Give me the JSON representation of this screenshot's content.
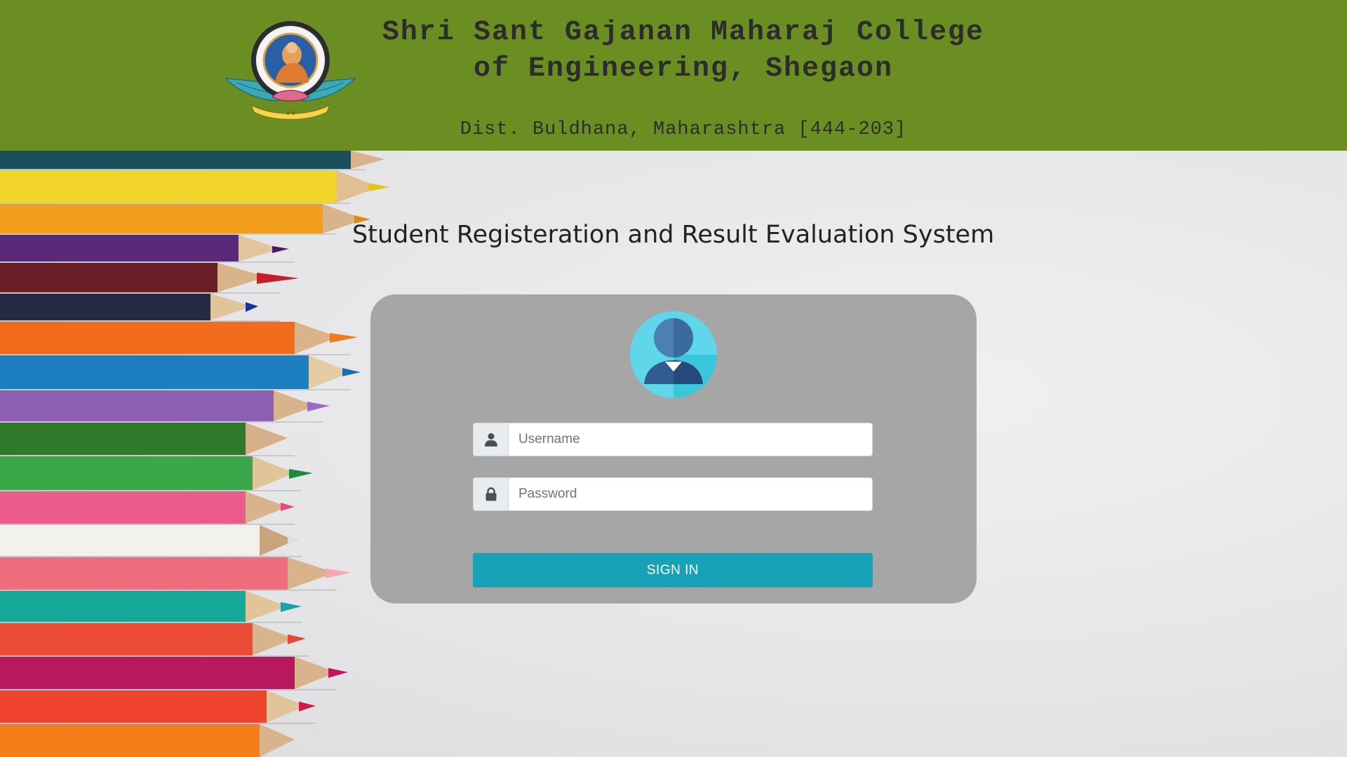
{
  "header": {
    "title_line1": "Shri Sant Gajanan Maharaj College",
    "title_line2": "of Engineering, Shegaon",
    "subtitle": "Dist. Buldhana, Maharashtra [444-203]",
    "logo_icon": "college-emblem-icon",
    "background_color": "#6b8e23"
  },
  "main": {
    "system_title": "Student Registeration and Result Evaluation System"
  },
  "login": {
    "avatar_icon": "user-avatar-icon",
    "username": {
      "icon": "user-icon",
      "placeholder": "Username",
      "value": ""
    },
    "password": {
      "icon": "lock-icon",
      "placeholder": "Password",
      "value": ""
    },
    "submit_label": "SIGN IN",
    "submit_color": "#17a2b8"
  }
}
